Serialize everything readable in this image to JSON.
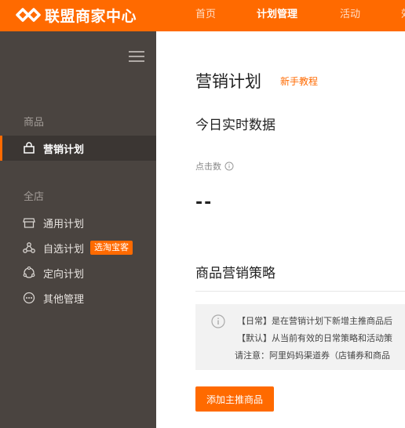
{
  "header": {
    "logo_text": "联盟商家中心",
    "nav": [
      {
        "label": "首页"
      },
      {
        "label": "计划管理"
      },
      {
        "label": "活动"
      },
      {
        "label": "效"
      }
    ]
  },
  "sidebar": {
    "sections": [
      {
        "label": "商品"
      },
      {
        "label": "全店"
      }
    ],
    "items": [
      {
        "label": "营销计划"
      },
      {
        "label": "通用计划"
      },
      {
        "label": "自选计划",
        "badge": "选淘宝客"
      },
      {
        "label": "定向计划"
      },
      {
        "label": "其他管理"
      }
    ]
  },
  "main": {
    "title": "营销计划",
    "tutorial_link": "新手教程",
    "realtime_title": "今日实时数据",
    "metric": {
      "label": "点击数",
      "value": "--"
    },
    "strategy_title": "商品营销策略",
    "notice_lines": [
      "【日常】是在营销计划下新增主推商品后",
      "【默认】从当前有效的日常策略和活动策",
      "请注意：阿里妈妈渠道券（店铺券和商品"
    ],
    "add_button": "添加主推商品"
  },
  "colors": {
    "brand_orange": "#ff6a00",
    "sidebar_bg": "#4a4440"
  }
}
